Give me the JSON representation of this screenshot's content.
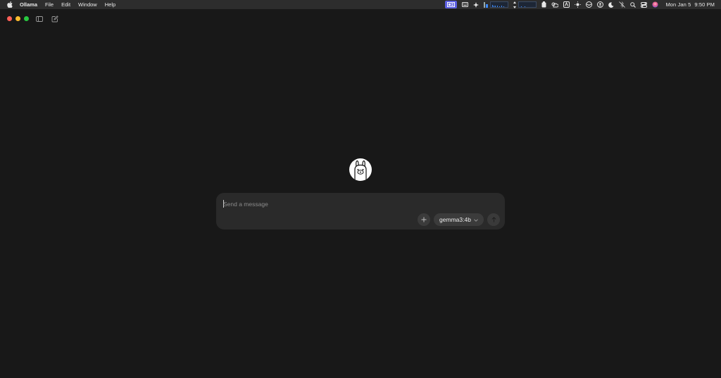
{
  "menubar": {
    "apple_icon": "apple-icon",
    "app_name": "Ollama",
    "menus": [
      "File",
      "Edit",
      "Window",
      "Help"
    ],
    "clock_date": "Mon Jan 5",
    "clock_time": "9:50 PM",
    "tray_icons": [
      "display-icon",
      "keyboard-icon",
      "sparkle-icon",
      "cpu-graph-icon",
      "network-graph-icon",
      "clipboard-icon",
      "weather-icon",
      "text-icon",
      "brightness-icon",
      "layers-icon",
      "account-icon",
      "moon-icon",
      "no-bluetooth-icon",
      "search-icon",
      "control-center-icon",
      "siri-icon"
    ],
    "accent_color": "#5b5ee0"
  },
  "window": {
    "traffic_lights": [
      "close",
      "minimize",
      "maximize"
    ],
    "sidebar_toggle_icon": "sidebar-icon",
    "new_chat_icon": "new-chat-icon"
  },
  "main": {
    "logo_icon": "ollama-llama-icon",
    "composer": {
      "placeholder": "Send a message",
      "value": "",
      "attach_icon": "plus-icon",
      "model_label": "gemma3:4b",
      "model_dropdown_icon": "chevron-down-icon",
      "send_icon": "arrow-up-icon"
    }
  }
}
